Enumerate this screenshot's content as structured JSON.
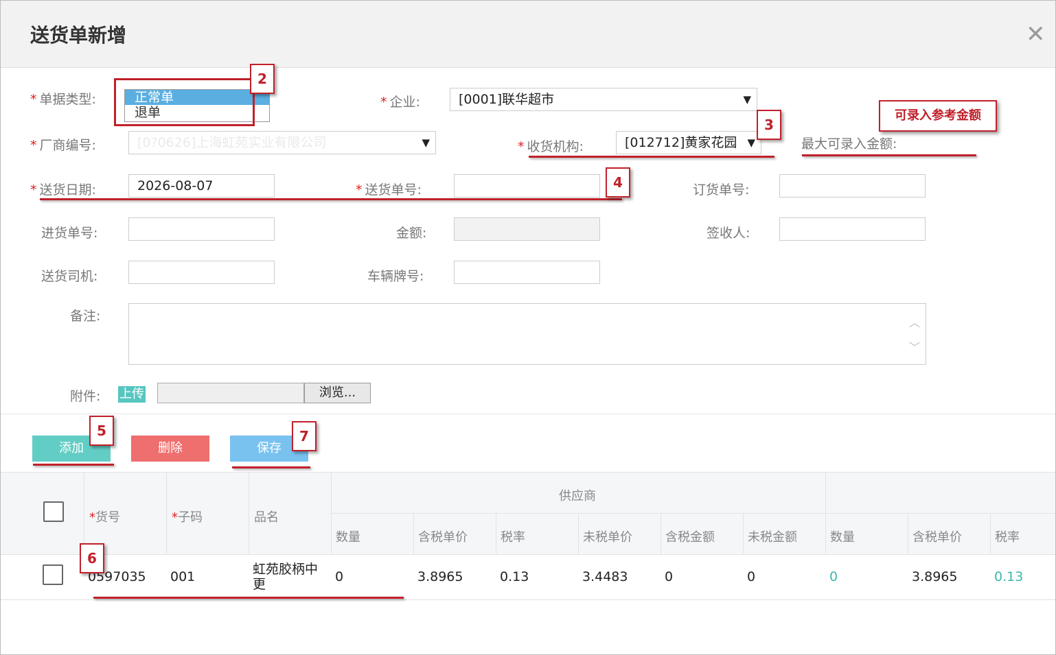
{
  "dialog": {
    "title": "送货单新增"
  },
  "form": {
    "doc_type": {
      "label": "单据类型:",
      "options": [
        "正常单",
        "退单"
      ],
      "selected": "正常单"
    },
    "company": {
      "label": "企业:",
      "value": "[0001]联华超市"
    },
    "vendor_code": {
      "label": "厂商编号:",
      "value": "[0?0626]上海虹苑实业有限公司"
    },
    "receiving_org": {
      "label": "收货机构:",
      "value": "[012712]黄家花园"
    },
    "max_amount": {
      "label": "最大可录入金额:"
    },
    "delivery_date": {
      "label": "送货日期:",
      "value": "2026-08-07"
    },
    "delivery_no": {
      "label": "送货单号:",
      "value": ""
    },
    "order_no": {
      "label": "订货单号:",
      "value": ""
    },
    "purchase_no": {
      "label": "进货单号:",
      "value": ""
    },
    "amount": {
      "label": "金额:",
      "value": ""
    },
    "signer": {
      "label": "签收人:",
      "value": ""
    },
    "driver": {
      "label": "送货司机:",
      "value": ""
    },
    "plate": {
      "label": "车辆牌号:",
      "value": ""
    },
    "remark": {
      "label": "备注:",
      "value": ""
    },
    "attachment": {
      "label": "附件:",
      "upload_label": "上传",
      "browse_label": "浏览..."
    }
  },
  "toolbar": {
    "add_label": "添加",
    "delete_label": "删除",
    "save_label": "保存"
  },
  "table": {
    "group_header": "供应商",
    "columns": {
      "item_no": "货号",
      "sub_code": "子码",
      "name": "品名",
      "qty": "数量",
      "price_tax": "含税单价",
      "tax_rate": "税率",
      "price_notax": "未税单价",
      "amount_tax": "含税金额",
      "amount_notax": "未税金额",
      "qty2": "数量",
      "price_tax2": "含税单价",
      "tax_rate2": "税率"
    },
    "rows": [
      {
        "item_no": "0597035",
        "sub_code": "001",
        "name_line1": "虹苑胶柄中",
        "name_line2": "更",
        "qty": "0",
        "price_tax": "3.8965",
        "tax_rate": "0.13",
        "price_notax": "3.4483",
        "amount_tax": "0",
        "amount_notax": "0",
        "qty2": "0",
        "price_tax2": "3.8965",
        "tax_rate2": "0.13"
      }
    ]
  },
  "annotations": {
    "callout_text": "可录入参考金额",
    "n2": "2",
    "n3": "3",
    "n4": "4",
    "n5": "5",
    "n6": "6",
    "n7": "7"
  },
  "colors": {
    "accent_red": "#c0202a",
    "add_button": "#62cdc5",
    "delete_button": "#ef6e6e",
    "save_button": "#79c2f0",
    "teal_value": "#3cb6ae"
  }
}
